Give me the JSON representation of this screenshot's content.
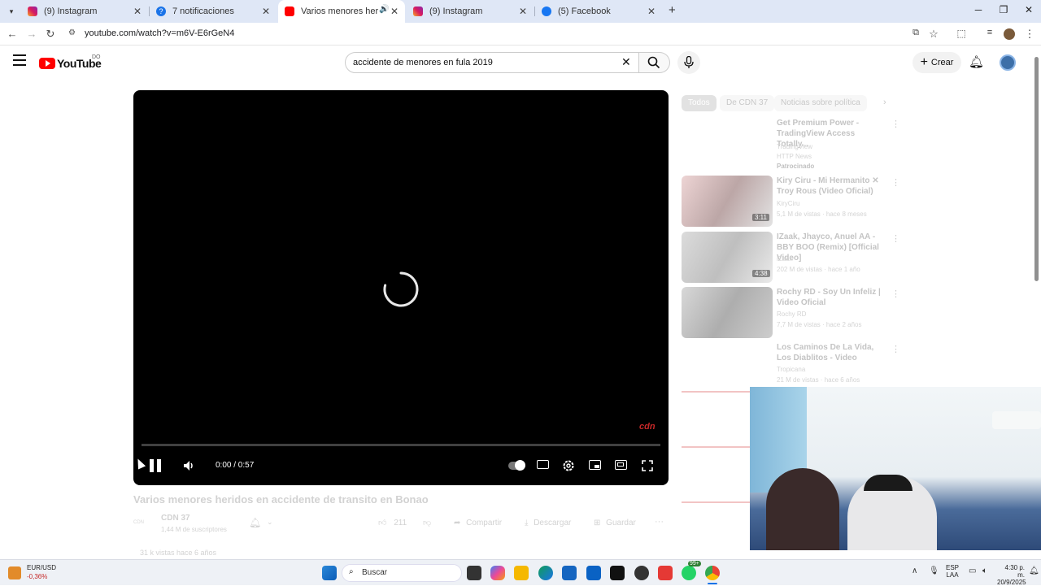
{
  "browser": {
    "tabs": [
      {
        "label": "(9) Instagram"
      },
      {
        "label": "7 notificaciones"
      },
      {
        "label": "Varios menores heridos en"
      },
      {
        "label": "(9) Instagram"
      },
      {
        "label": "(5) Facebook"
      }
    ],
    "url": "youtube.com/watch?v=m6V-E6rGeN4"
  },
  "youtube": {
    "logo_text": "YouTube",
    "country_code": "DO",
    "search_value": "accidente de menores en fula 2019",
    "create_label": "Crear",
    "player": {
      "time": "0:00 / 0:57",
      "watermark": "cdn"
    },
    "video": {
      "title": "Varios menores heridos en accidente de transito en Bonao",
      "channel": "CDN 37",
      "subscribers": "1,44 M de suscriptores",
      "likes": "211",
      "share_label": "Compartir",
      "download_label": "Descargar",
      "save_label": "Guardar",
      "views": "31 k vistas  hace 6 años",
      "channel_avatar_text": "CDN"
    },
    "chips": [
      "Todos",
      "De CDN 37",
      "Noticias sobre política"
    ],
    "recommendations": [
      {
        "title": "Get Premium Power - TradingView Access Totally...",
        "channel": "TradingView",
        "meta": "HTTP News",
        "tag": "Patrocinado"
      },
      {
        "title": "Kiry Ciru - Mi Hermanito ✕ Troy Rous (Video Oficial)",
        "channel": "KiryCiru",
        "meta": "5,1 M de vistas · hace 8 meses",
        "duration": "3:11"
      },
      {
        "title": "IZaak, Jhayco, Anuel AA - BBY BOO (Remix) [Official Video]",
        "channel": "iZaak",
        "meta": "202 M de vistas · hace 1 año",
        "duration": "4:38"
      },
      {
        "title": "Rochy RD - Soy Un Infeliz | Video Oficial",
        "channel": "Rochy RD",
        "meta": "7,7 M de vistas · hace 2 años",
        "duration": ""
      },
      {
        "title": "Los Caminos De La Vida, Los Diablitos - Video",
        "channel": "Tropicana",
        "meta": "21 M de vistas · hace 6 años",
        "duration": ""
      }
    ]
  },
  "taskbar": {
    "ticker_symbol": "EUR/USD",
    "ticker_change": "-0,36%",
    "search_placeholder": "Buscar",
    "lang": "ESP",
    "lang_sub": "LAA",
    "time": "4:30 p. m.",
    "date": "20/9/2025",
    "badge": "99+"
  },
  "colors": {
    "youtube_red": "#ff0000",
    "tab_strip": "#dfe7f6",
    "taskbar": "#eef1f6"
  }
}
